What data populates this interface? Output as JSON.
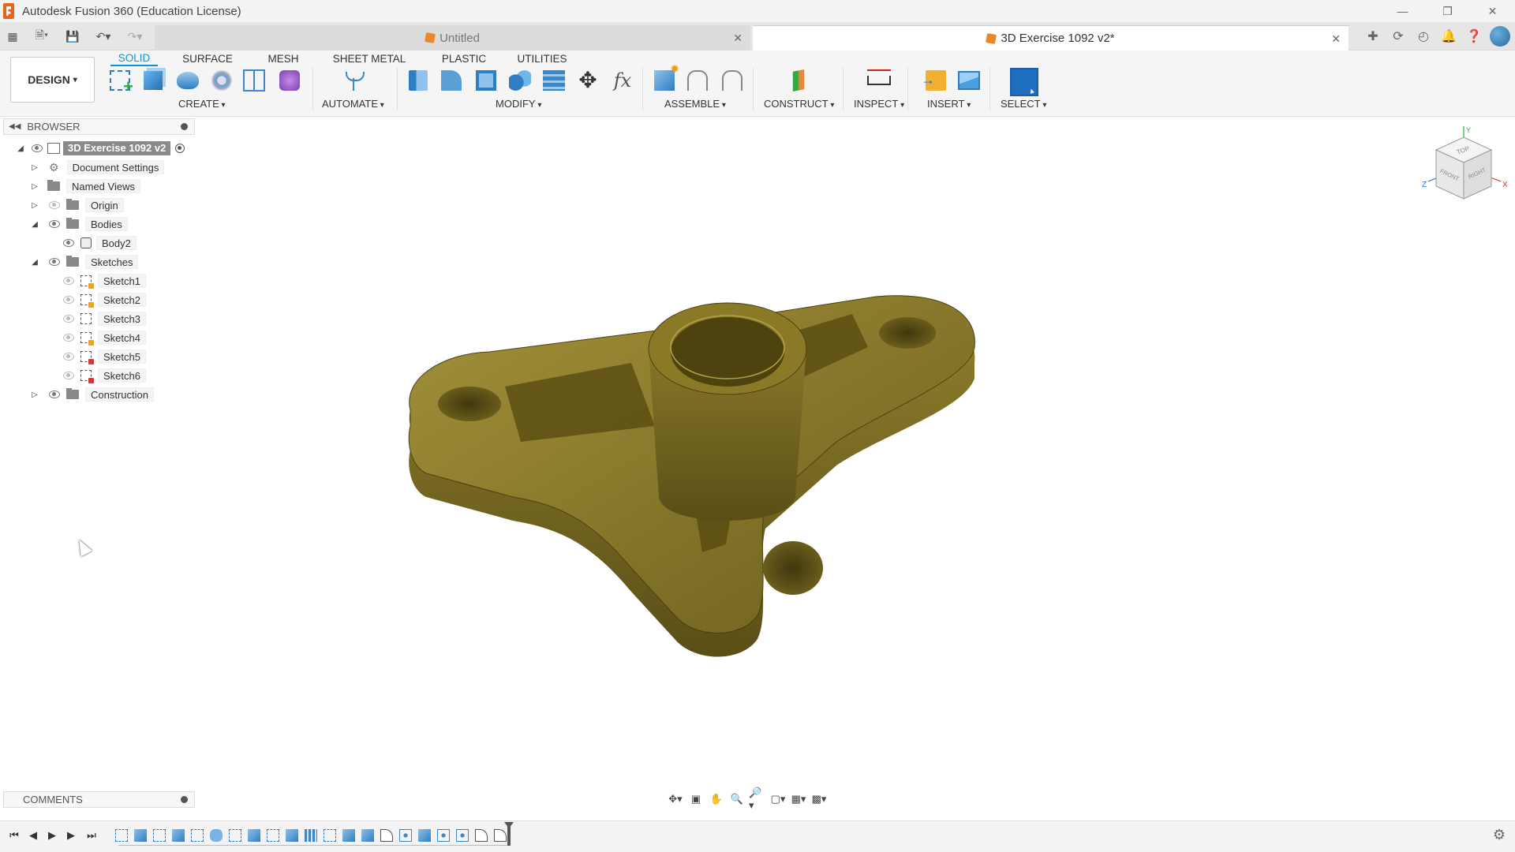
{
  "window": {
    "title": "Autodesk Fusion 360 (Education License)"
  },
  "tabs": [
    {
      "label": "Untitled",
      "active": false
    },
    {
      "label": "3D Exercise 1092 v2*",
      "active": true
    }
  ],
  "workspace": {
    "label": "DESIGN"
  },
  "ribbon_tabs": [
    "SOLID",
    "SURFACE",
    "MESH",
    "SHEET METAL",
    "PLASTIC",
    "UTILITIES"
  ],
  "ribbon_groups": {
    "create": "CREATE",
    "automate": "AUTOMATE",
    "modify": "MODIFY",
    "assemble": "ASSEMBLE",
    "construct": "CONSTRUCT",
    "inspect": "INSPECT",
    "insert": "INSERT",
    "select": "SELECT"
  },
  "browser": {
    "title": "BROWSER",
    "root": "3D Exercise 1092 v2",
    "items": [
      {
        "label": "Document Settings"
      },
      {
        "label": "Named Views"
      },
      {
        "label": "Origin"
      },
      {
        "label": "Bodies"
      },
      {
        "label": "Body2"
      },
      {
        "label": "Sketches"
      },
      {
        "label": "Sketch1"
      },
      {
        "label": "Sketch2"
      },
      {
        "label": "Sketch3"
      },
      {
        "label": "Sketch4"
      },
      {
        "label": "Sketch5"
      },
      {
        "label": "Sketch6"
      },
      {
        "label": "Construction"
      }
    ]
  },
  "viewcube": {
    "top": "TOP",
    "front": "FRONT",
    "right": "RIGHT",
    "axis_x": "X",
    "axis_y": "Y",
    "axis_z": "Z"
  },
  "comments": {
    "title": "COMMENTS"
  },
  "colors": {
    "accent": "#0696d7",
    "model": "#6b5d1c",
    "select_tool": "#1f6fc0"
  }
}
